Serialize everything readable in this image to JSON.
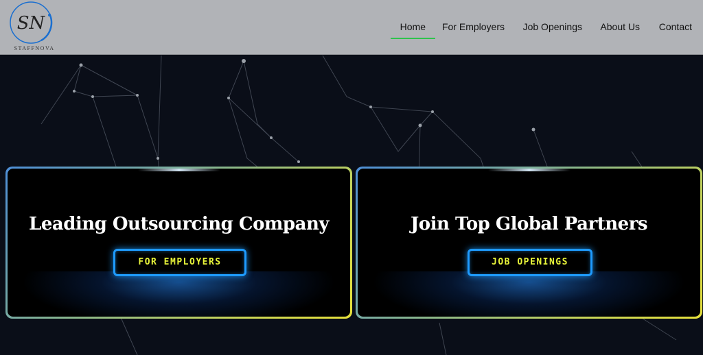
{
  "brand": {
    "logo_text": "STAFFNOVA",
    "monogram": "SN"
  },
  "nav": {
    "items": [
      {
        "label": "Home",
        "active": true
      },
      {
        "label": "For Employers",
        "active": false
      },
      {
        "label": "Job Openings",
        "active": false
      },
      {
        "label": "About Us",
        "active": false
      },
      {
        "label": "Contact",
        "active": false
      }
    ]
  },
  "cards": [
    {
      "title": "Leading Outsourcing Company",
      "button_label": "FOR EMPLOYERS"
    },
    {
      "title": "Join Top Global Partners",
      "button_label": "JOB OPENINGS"
    }
  ],
  "colors": {
    "header_bg": "#b1b3b7",
    "page_bg": "#0a0e18",
    "active_underline": "#2ec24d",
    "button_border": "#1e9bff",
    "button_text": "#e9f53a"
  }
}
